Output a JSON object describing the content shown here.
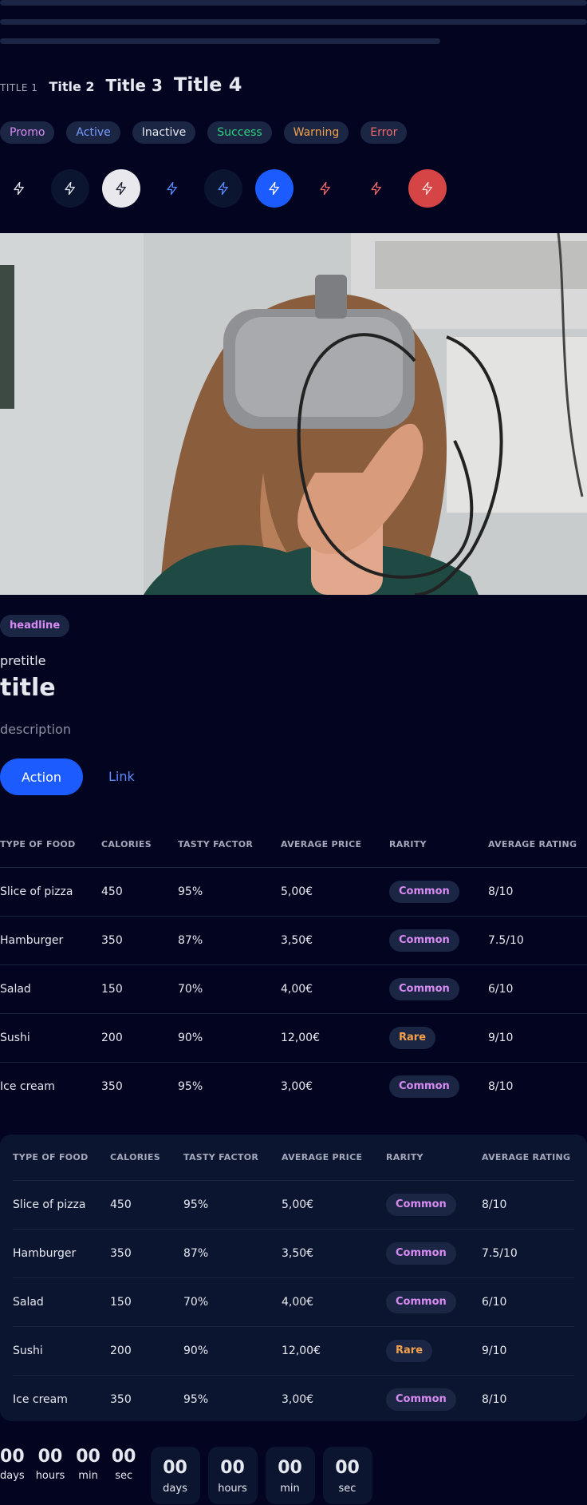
{
  "titles": [
    "TITLE 1",
    "Title 2",
    "Title 3",
    "Title 4"
  ],
  "badges": [
    {
      "label": "Promo",
      "color": "#d88bf2"
    },
    {
      "label": "Active",
      "color": "#7a9bff"
    },
    {
      "label": "Inactive",
      "color": "#e6e8f0"
    },
    {
      "label": "Success",
      "color": "#2fd07d"
    },
    {
      "label": "Warning",
      "color": "#f3a04b"
    },
    {
      "label": "Error",
      "color": "#f06a6a"
    }
  ],
  "icon_buttons": [
    {
      "icon": "bolt-icon",
      "variant": "plain-neutral"
    },
    {
      "icon": "bolt-icon",
      "variant": "soft-neutral"
    },
    {
      "icon": "bolt-icon",
      "variant": "solid-neutral"
    },
    {
      "icon": "bolt-icon",
      "variant": "plain-primary"
    },
    {
      "icon": "bolt-icon",
      "variant": "soft-primary"
    },
    {
      "icon": "bolt-icon",
      "variant": "solid-primary"
    },
    {
      "icon": "bolt-icon",
      "variant": "plain-danger"
    },
    {
      "icon": "bolt-icon",
      "variant": "soft-danger"
    },
    {
      "icon": "bolt-icon",
      "variant": "solid-danger"
    }
  ],
  "card": {
    "headline": "headline",
    "pretitle": "pretitle",
    "title": "title",
    "description": "description",
    "action": "Action",
    "link": "Link"
  },
  "table": {
    "headers": [
      "TYPE OF FOOD",
      "CALORIES",
      "TASTY FACTOR",
      "AVERAGE PRICE",
      "RARITY",
      "AVERAGE RATING"
    ],
    "rows": [
      {
        "food": "Slice of pizza",
        "calories": "450",
        "tasty": "95%",
        "price": "5,00€",
        "rarity": "Common",
        "rating": "8/10"
      },
      {
        "food": "Hamburger",
        "calories": "350",
        "tasty": "87%",
        "price": "3,50€",
        "rarity": "Common",
        "rating": "7.5/10"
      },
      {
        "food": "Salad",
        "calories": "150",
        "tasty": "70%",
        "price": "4,00€",
        "rarity": "Common",
        "rating": "6/10"
      },
      {
        "food": "Sushi",
        "calories": "200",
        "tasty": "90%",
        "price": "12,00€",
        "rarity": "Rare",
        "rating": "9/10"
      },
      {
        "food": "Ice cream",
        "calories": "350",
        "tasty": "95%",
        "price": "3,00€",
        "rarity": "Common",
        "rating": "8/10"
      }
    ]
  },
  "rarity_colors": {
    "Common": "#d88bf2",
    "Rare": "#f3a04b"
  },
  "countdown": {
    "values": [
      "00",
      "00",
      "00",
      "00"
    ],
    "labels": [
      "days",
      "hours",
      "min",
      "sec"
    ]
  },
  "colors": {
    "primary": "#1c5cff",
    "danger": "#d64545",
    "background": "#03041f",
    "surface": "#0c1530"
  }
}
